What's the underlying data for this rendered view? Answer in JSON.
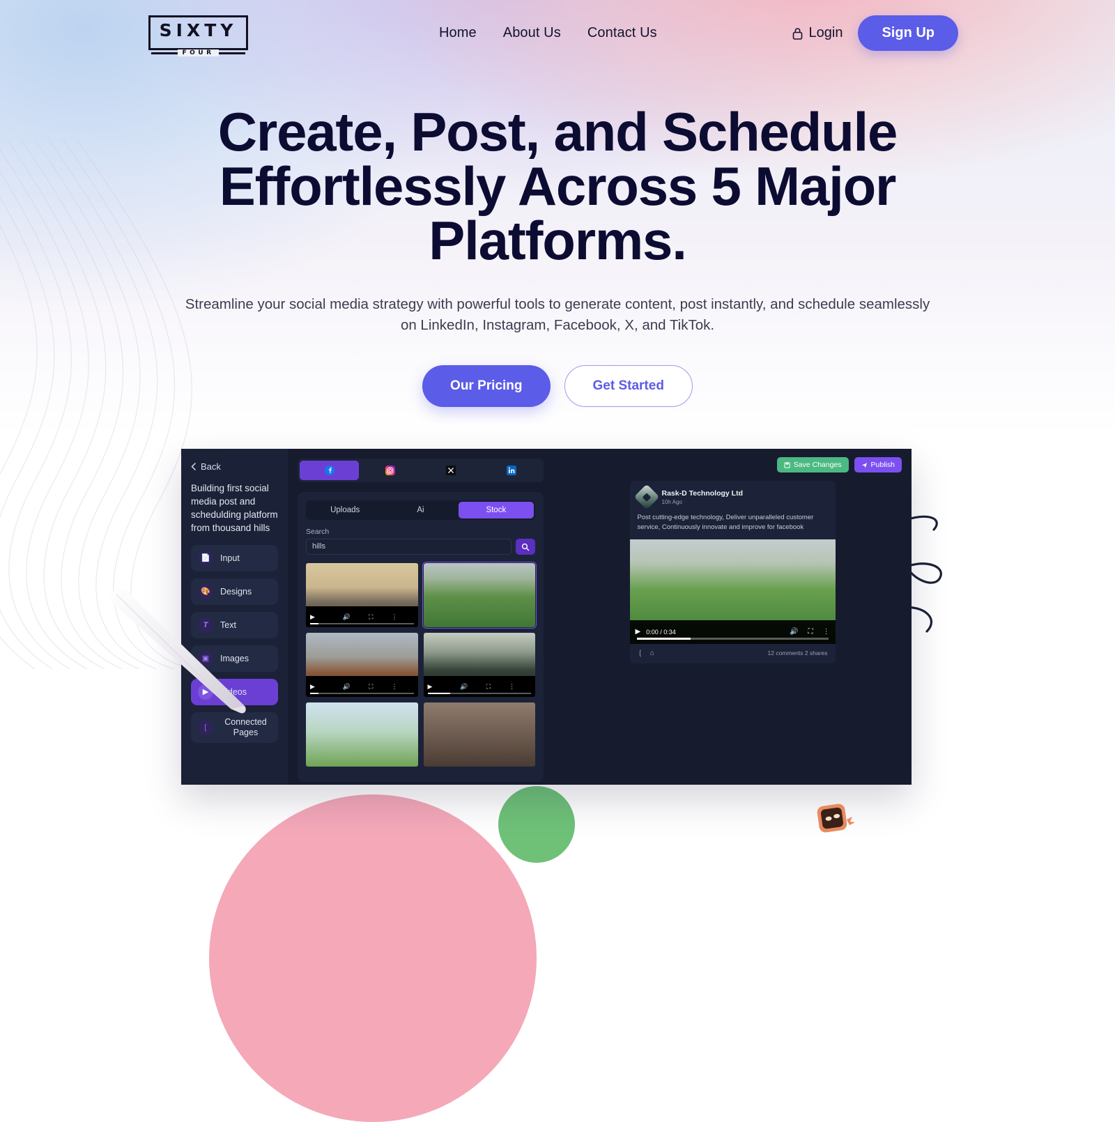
{
  "brand": {
    "name_top": "SIXTY",
    "name_bottom": "FOUR"
  },
  "nav": {
    "items": [
      {
        "label": "Home"
      },
      {
        "label": "About Us"
      },
      {
        "label": "Contact Us"
      }
    ]
  },
  "auth": {
    "login_label": "Login",
    "login_icon": "lock-icon",
    "signup_label": "Sign Up"
  },
  "hero": {
    "headline": "Create, Post, and Schedule Effortlessly Across 5 Major Platforms.",
    "subtitle": "Streamline your social media strategy with powerful tools to generate content, post instantly, and schedule seamlessly on LinkedIn, Instagram, Facebook, X, and TikTok.",
    "primary_cta": "Our Pricing",
    "secondary_cta": "Get Started"
  },
  "colors": {
    "accent": "#5b5ce8",
    "app_accent": "#7c4ff0",
    "headline": "#0c0c33",
    "save_green": "#4bb981",
    "blob_pink": "#f4a8b8",
    "blob_green": "#6fc178",
    "app_bg": "#161b2e",
    "app_sidebar": "#1b2137"
  },
  "app": {
    "back_label": "Back",
    "back_icon": "chevron-left-icon",
    "project_title": "Building first social media post and schedulding platform from thousand hills",
    "sidebar_items": [
      {
        "label": "Input",
        "icon": "document-icon",
        "active": false
      },
      {
        "label": "Designs",
        "icon": "palette-icon",
        "active": false
      },
      {
        "label": "Text",
        "icon": "text-icon",
        "active": false
      },
      {
        "label": "Images",
        "icon": "image-icon",
        "active": false
      },
      {
        "label": "Videos",
        "icon": "video-icon",
        "active": true
      },
      {
        "label": "Connected Pages",
        "icon": "share-icon",
        "active": false
      }
    ],
    "platforms": [
      {
        "name": "facebook-icon",
        "active": true
      },
      {
        "name": "instagram-icon",
        "active": false
      },
      {
        "name": "x-icon",
        "active": false
      },
      {
        "name": "linkedin-icon",
        "active": false
      }
    ],
    "tabs": [
      {
        "label": "Uploads",
        "active": false
      },
      {
        "label": "Ai",
        "active": false
      },
      {
        "label": "Stock",
        "active": true
      }
    ],
    "search": {
      "label": "Search",
      "value": "hills",
      "placeholder": "Search",
      "button_icon": "search-icon"
    },
    "media": [
      {
        "caption": "misty-mountain-sunset",
        "selected": false,
        "progress": 8
      },
      {
        "caption": "green-rolling-hills",
        "selected": true,
        "progress": 0
      },
      {
        "caption": "red-rock-desert",
        "selected": false,
        "progress": 8
      },
      {
        "caption": "forested-limestone-peaks",
        "selected": false,
        "progress": 22
      },
      {
        "caption": "trees-and-meadow",
        "selected": false,
        "progress": 0
      },
      {
        "caption": "dry-brown-hillside",
        "selected": false,
        "progress": 0
      }
    ],
    "actions": {
      "save_label": "Save Changes",
      "save_icon": "save-icon",
      "publish_label": "Publish",
      "publish_icon": "send-icon"
    },
    "preview": {
      "account_name": "Rask-D Technology Ltd",
      "timestamp": "10h Ago",
      "post_text": "Post cutting-edge technology, Deliver unparalleled customer service, Continuously innovate and improve for facebook",
      "video_time": "0:00 / 0:34",
      "video_progress": 28,
      "stats": "12 comments 2 shares",
      "footer_icons": [
        "share-icon",
        "home-icon"
      ],
      "player_icons": [
        "play-icon",
        "volume-icon",
        "fullscreen-icon",
        "more-icon"
      ]
    }
  }
}
